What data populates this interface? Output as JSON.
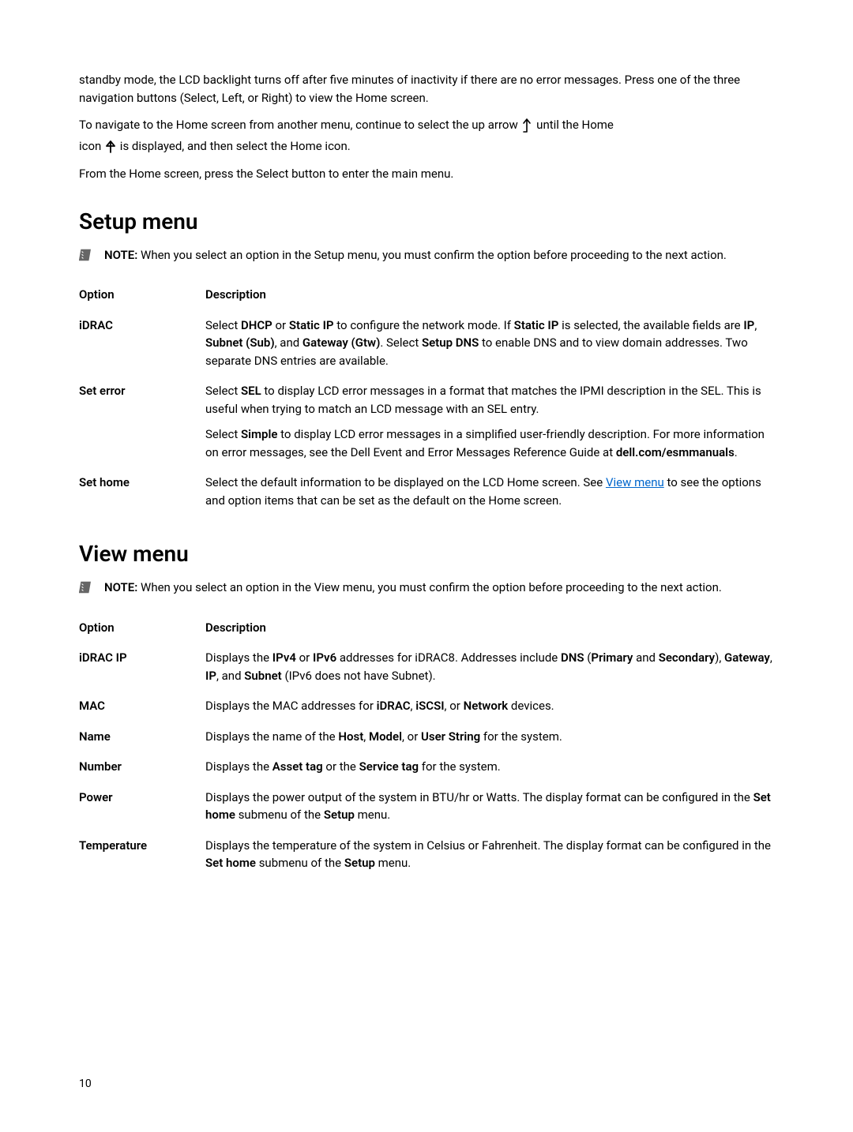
{
  "intro": {
    "p1": "standby mode, the LCD backlight turns off after five minutes of inactivity if there are no error messages. Press one of the three navigation buttons (Select, Left, or Right) to view the Home screen.",
    "p2a": "To navigate to the Home screen from another menu, continue to select the up arrow ",
    "p2b": " until the Home",
    "p3a": "icon ",
    "p3b": " is displayed, and then select the Home icon.",
    "p4": "From the Home screen, press the Select button to enter the main menu."
  },
  "setup": {
    "heading": "Setup menu",
    "note_label": "NOTE: ",
    "note_text": "When you select an option in the Setup menu, you must confirm the option before proceeding to the next action.",
    "option_header": "Option",
    "description_header": "Description",
    "idrac": {
      "label": "iDRAC",
      "d1": "Select ",
      "b1": "DHCP",
      "d2": " or ",
      "b2": "Static IP",
      "d3": " to configure the network mode. If ",
      "b3": "Static IP",
      "d4": " is selected, the available fields are ",
      "b4": "IP",
      "d5": ", ",
      "b5": "Subnet (Sub)",
      "d6": ", and ",
      "b6": "Gateway (Gtw)",
      "d7": ". Select ",
      "b7": "Setup DNS",
      "d8": " to enable DNS and to view domain addresses. Two separate DNS entries are available."
    },
    "seterror": {
      "label": "Set error",
      "p1a": "Select ",
      "p1b1": "SEL",
      "p1b": " to display LCD error messages in a format that matches the IPMI description in the SEL. This is useful when trying to match an LCD message with an SEL entry.",
      "p2a": "Select ",
      "p2b1": "Simple",
      "p2b": " to display LCD error messages in a simplified user-friendly description. For more information on error messages, see the Dell Event and Error Messages Reference Guide at ",
      "p2b2": "dell.com/esmmanuals",
      "p2c": "."
    },
    "sethome": {
      "label": "Set home",
      "d1": "Select the default information to be displayed on the LCD Home screen. See ",
      "link": "View menu",
      "d2": " to see the options and option items that can be set as the default on the Home screen."
    }
  },
  "view": {
    "heading": "View menu",
    "note_label": "NOTE: ",
    "note_text": "When you select an option in the View menu, you must confirm the option before proceeding to the next action.",
    "option_header": "Option",
    "description_header": "Description",
    "idracip": {
      "label": "iDRAC IP",
      "d1": "Displays the ",
      "b1": "IPv4",
      "d2": " or ",
      "b2": "IPv6",
      "d3": " addresses for iDRAC8. Addresses include ",
      "b3": "DNS",
      "d4": " (",
      "b4": "Primary",
      "d5": " and ",
      "b5": "Secondary",
      "d6": "), ",
      "b6": "Gateway",
      "d7": ", ",
      "b7": "IP",
      "d8": ", and ",
      "b8": "Subnet",
      "d9": " (IPv6 does not have Subnet)."
    },
    "mac": {
      "label": "MAC",
      "d1": "Displays the MAC addresses for ",
      "b1": "iDRAC",
      "d2": ", ",
      "b2": "iSCSI",
      "d3": ", or ",
      "b3": "Network",
      "d4": " devices."
    },
    "name": {
      "label": "Name",
      "d1": "Displays the name of the ",
      "b1": "Host",
      "d2": ", ",
      "b2": "Model",
      "d3": ", or ",
      "b3": "User String",
      "d4": " for the system."
    },
    "number": {
      "label": "Number",
      "d1": "Displays the ",
      "b1": "Asset tag",
      "d2": " or the ",
      "b2": "Service tag",
      "d3": " for the system."
    },
    "power": {
      "label": "Power",
      "d1": "Displays the power output of the system in BTU/hr or Watts. The display format can be configured in the ",
      "b1": "Set home",
      "d2": " submenu of the ",
      "b2": "Setup",
      "d3": " menu."
    },
    "temperature": {
      "label": "Temperature",
      "d1": "Displays the temperature of the system in Celsius or Fahrenheit. The display format can be configured in the ",
      "b1": "Set home",
      "d2": " submenu of the ",
      "b2": "Setup",
      "d3": " menu."
    }
  },
  "page_number": "10"
}
